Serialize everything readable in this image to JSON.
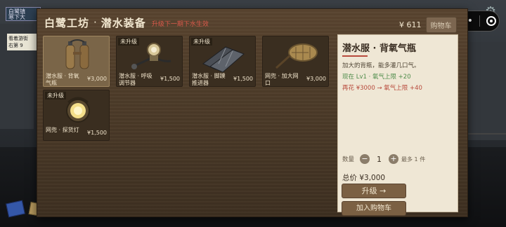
{
  "background": {
    "street_sign_line1": "白鹭镇",
    "street_sign_line2": "寒下大",
    "sign2_line1": "看着游街",
    "sign2_line2": "右第 9"
  },
  "header": {
    "shop_name": "白鹭工坊",
    "separator": "·",
    "category": "潜水装备",
    "notice": "升级下一期下水生效",
    "money": "¥ 611",
    "cart_label": "购物车"
  },
  "items": [
    {
      "tag": "",
      "name": "潜水服 · 背氧气瓶",
      "price": "¥3,000",
      "icon": "oxygen-tank-icon",
      "selected": true
    },
    {
      "tag": "未升级",
      "name": "潜水服 · 呼吸调节器",
      "price": "¥1,500",
      "icon": "regulator-icon",
      "selected": false
    },
    {
      "tag": "未升级",
      "name": "潜水服 · 脚蹼推进器",
      "price": "¥1,500",
      "icon": "flippers-icon",
      "selected": false
    },
    {
      "tag": "",
      "name": "网兜 · 加大网口",
      "price": "¥3,000",
      "icon": "net-icon",
      "selected": false
    },
    {
      "tag": "未升级",
      "name": "网兜 · 探货灯",
      "price": "¥1,500",
      "icon": "lamp-icon",
      "selected": false
    }
  ],
  "detail": {
    "title": "潜水服 · 背氧气瓶",
    "description": "加大的背瓶，能多灌几口气。",
    "current": "现在 Lv1 · 氧气上限 +20",
    "next": "再花 ¥3000 → 氧气上限 +40",
    "qty_label": "数量",
    "qty_minus": "−",
    "qty_value": "1",
    "qty_plus": "+",
    "qty_max": "最多 1 件",
    "total": "总价 ¥3,000",
    "upgrade_label": "升级 →",
    "add_to_cart_label": "加入购物车"
  },
  "colors": {
    "panel": "#4a3a28",
    "detail_bg": "#efe7d5",
    "accent_red": "#b84a3c",
    "accent_green": "#4e8c4a",
    "button": "#7b6043"
  }
}
